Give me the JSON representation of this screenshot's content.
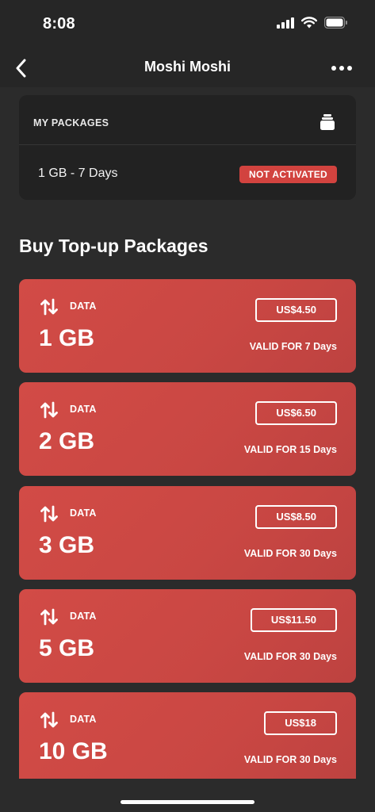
{
  "status": {
    "time": "8:08"
  },
  "nav": {
    "title": "Moshi Moshi"
  },
  "my_packages": {
    "title": "MY PACKAGES",
    "package_name": "1 GB - 7 Days",
    "status_badge": "NOT ACTIVATED"
  },
  "topup": {
    "title": "Buy Top-up Packages",
    "cards": [
      {
        "type": "DATA",
        "amount": "1 GB",
        "price": "US$4.50",
        "validity": "VALID FOR 7 Days"
      },
      {
        "type": "DATA",
        "amount": "2 GB",
        "price": "US$6.50",
        "validity": "VALID FOR 15 Days"
      },
      {
        "type": "DATA",
        "amount": "3 GB",
        "price": "US$8.50",
        "validity": "VALID FOR 30 Days"
      },
      {
        "type": "DATA",
        "amount": "5 GB",
        "price": "US$11.50",
        "validity": "VALID FOR 30 Days"
      },
      {
        "type": "DATA",
        "amount": "10 GB",
        "price": "US$18",
        "validity": "VALID FOR 30 Days"
      }
    ]
  },
  "colors": {
    "accent": "#d2433f",
    "card": "#cd4945",
    "background": "#2b2b2b",
    "panel": "#222222"
  },
  "icons": [
    "cellular-signal-icon",
    "wifi-icon",
    "battery-icon",
    "back-chevron-icon",
    "more-dots-icon",
    "package-stack-icon",
    "data-transfer-icon"
  ]
}
